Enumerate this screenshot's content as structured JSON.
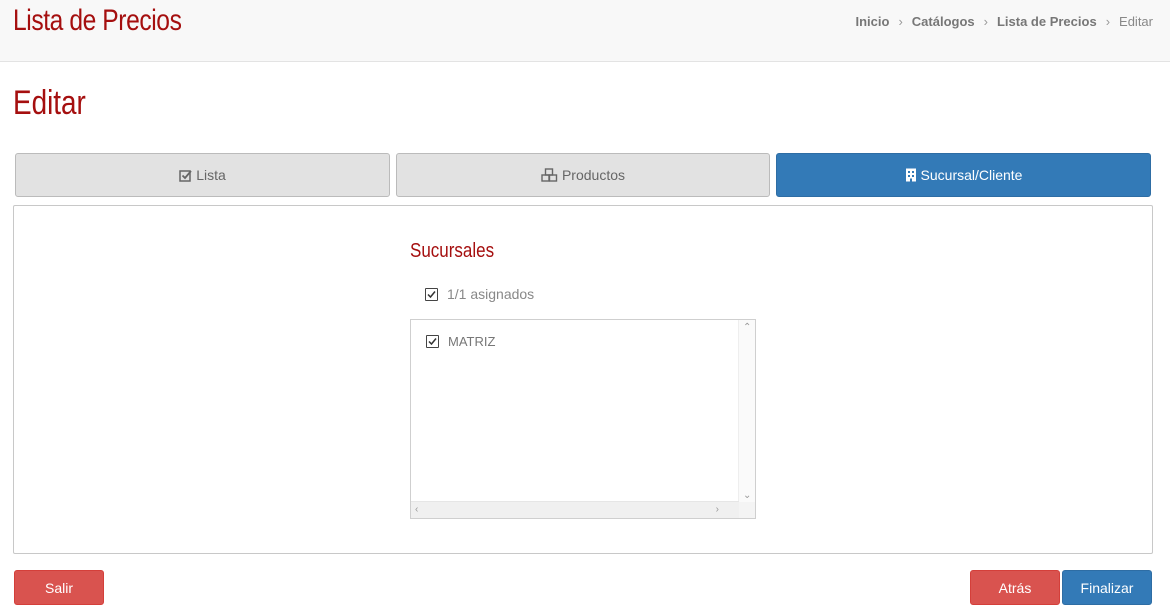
{
  "header": {
    "app_title": "Lista de Precios",
    "breadcrumb": [
      {
        "label": "Inicio"
      },
      {
        "label": "Catálogos"
      },
      {
        "label": "Lista de Precios"
      }
    ],
    "breadcrumb_current": "Editar",
    "separator": "›"
  },
  "page": {
    "title": "Editar"
  },
  "tabs": [
    {
      "label": "Lista",
      "icon": "check-square-icon",
      "active": false
    },
    {
      "label": "Productos",
      "icon": "cubes-icon",
      "active": false
    },
    {
      "label": "Sucursal/Cliente",
      "icon": "building-icon",
      "active": true
    }
  ],
  "sucursales": {
    "title": "Sucursales",
    "assigned_label": "1/1 asignados",
    "assigned_checked": true,
    "items": [
      {
        "label": "MATRIZ",
        "checked": true
      }
    ]
  },
  "footer": {
    "exit_label": "Salir",
    "back_label": "Atrás",
    "finish_label": "Finalizar"
  },
  "colors": {
    "brand_red": "#a50f0f",
    "primary_blue": "#337ab7",
    "danger_red": "#d9534f",
    "tab_inactive": "#e2e2e2"
  }
}
